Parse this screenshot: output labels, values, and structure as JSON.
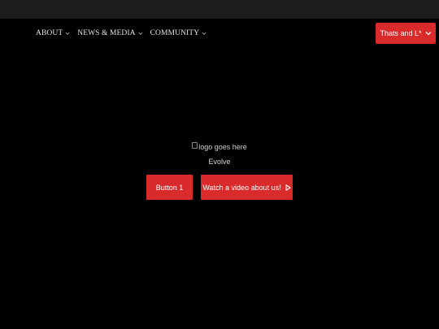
{
  "nav": {
    "items": [
      {
        "label": "ABOUT"
      },
      {
        "label": "NEWS & MEDIA"
      },
      {
        "label": "COMMUNITY"
      }
    ]
  },
  "top_cta": {
    "label": "Thats and L*"
  },
  "hero": {
    "logo_alt": "logo goes here",
    "tagline": "Evolve",
    "button_1": "Button 1",
    "button_2": "Watch a video about us!"
  },
  "colors": {
    "background": "#000000",
    "top_strip": "#1d1d1d",
    "accent": "#d92b2b",
    "text": "#ffffff"
  }
}
